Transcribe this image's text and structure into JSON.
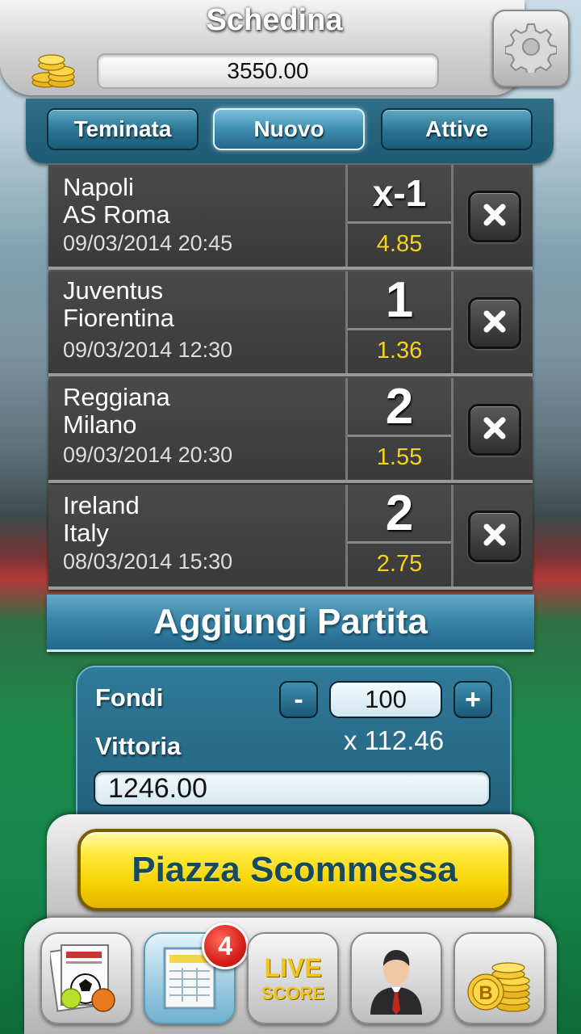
{
  "header": {
    "title": "Schedina",
    "balance": "3550.00"
  },
  "tabs": [
    {
      "label": "Teminata"
    },
    {
      "label": "Nuovo"
    },
    {
      "label": "Attive"
    }
  ],
  "matches": [
    {
      "home": "Napoli",
      "away": "AS Roma",
      "datetime": "09/03/2014 20:45",
      "pick": "x-1",
      "odds": "4.85"
    },
    {
      "home": "Juventus",
      "away": "Fiorentina",
      "datetime": "09/03/2014 12:30",
      "pick": "1",
      "odds": "1.36"
    },
    {
      "home": "Reggiana",
      "away": "Milano",
      "datetime": "09/03/2014 20:30",
      "pick": "2",
      "odds": "1.55"
    },
    {
      "home": "Ireland",
      "away": "Italy",
      "datetime": "08/03/2014 15:30",
      "pick": "2",
      "odds": "2.75"
    }
  ],
  "add_match_label": "Aggiungi Partita",
  "bet": {
    "funds_label": "Fondi",
    "minus": "-",
    "plus": "+",
    "stake": "100",
    "win_label": "Vittoria",
    "multiplier": "x 112.46",
    "potential_win": "1246.00"
  },
  "place_bet_label": "Piazza Scommessa",
  "nav": {
    "badge_count": "4",
    "live_line1": "LIVE",
    "live_line2": "SCORE",
    "items": [
      "news-icon",
      "betslip-icon",
      "live-score-icon",
      "manager-icon",
      "coins-icon"
    ]
  },
  "colors": {
    "odds": "#f4d41a",
    "panel_blue": "#2f7a99",
    "place_bet_yellow": "#f5d000",
    "badge_red": "#d8201a"
  }
}
